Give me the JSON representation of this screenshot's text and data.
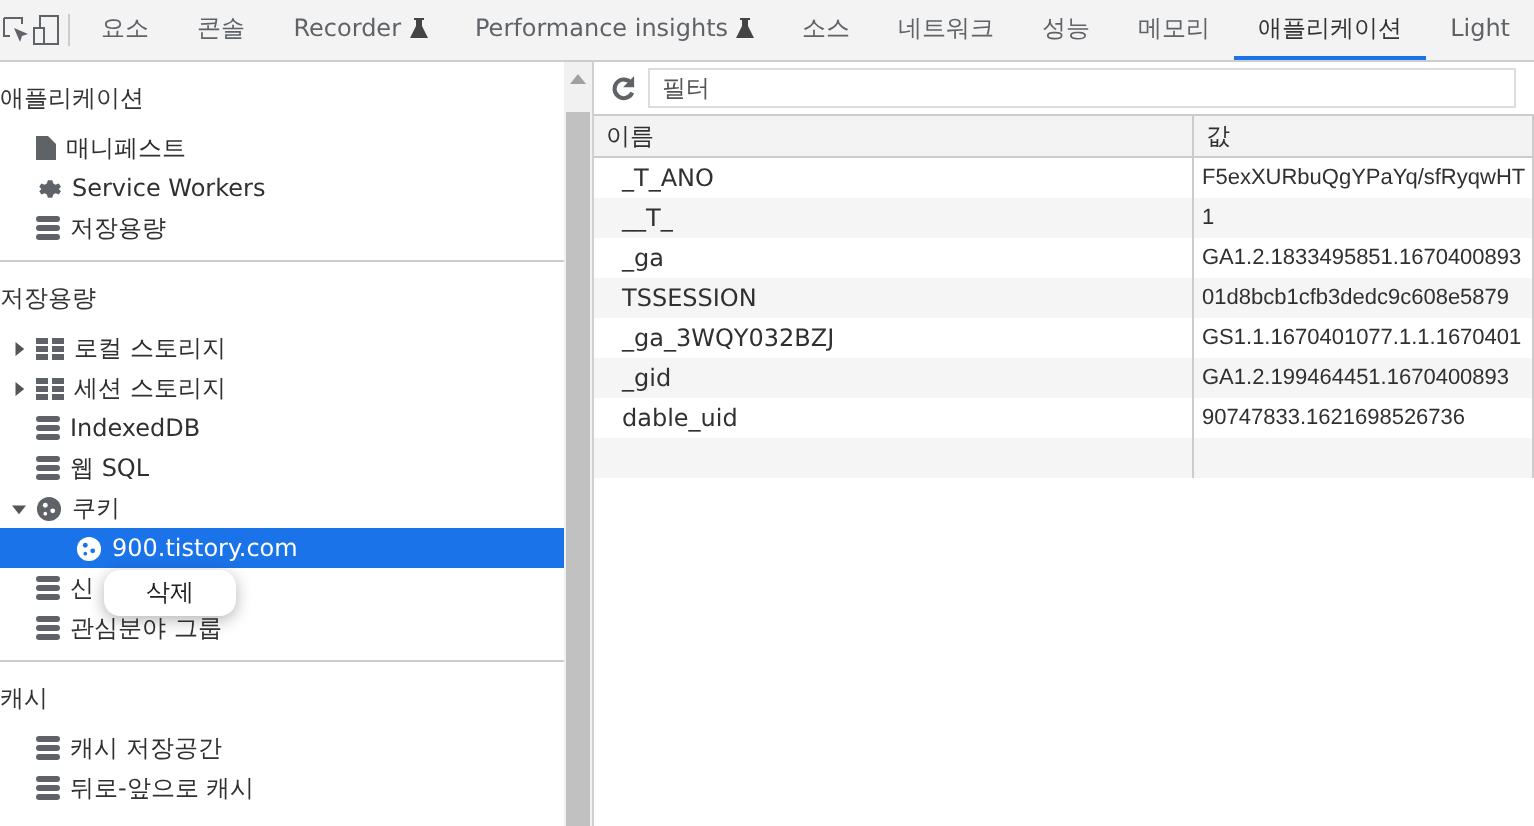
{
  "toolbar": {
    "tabs": [
      {
        "label": "요소",
        "selected": false,
        "experimental": false
      },
      {
        "label": "콘솔",
        "selected": false,
        "experimental": false
      },
      {
        "label": "Recorder",
        "selected": false,
        "experimental": true
      },
      {
        "label": "Performance insights",
        "selected": false,
        "experimental": true
      },
      {
        "label": "소스",
        "selected": false,
        "experimental": false
      },
      {
        "label": "네트워크",
        "selected": false,
        "experimental": false
      },
      {
        "label": "성능",
        "selected": false,
        "experimental": false
      },
      {
        "label": "메모리",
        "selected": false,
        "experimental": false
      },
      {
        "label": "애플리케이션",
        "selected": true,
        "experimental": false
      },
      {
        "label": "Light",
        "selected": false,
        "experimental": false
      }
    ]
  },
  "sidebar": {
    "sections": [
      {
        "title": "애플리케이션",
        "items": [
          {
            "label": "매니페스트",
            "kind": "file",
            "selected": false
          },
          {
            "label": "Service Workers",
            "kind": "gear",
            "selected": false
          },
          {
            "label": "저장용량",
            "kind": "db",
            "selected": false
          }
        ]
      },
      {
        "title": "저장용량",
        "items": [
          {
            "label": "로컬 스토리지",
            "kind": "grid",
            "selected": false,
            "expanded": false
          },
          {
            "label": "세션 스토리지",
            "kind": "grid",
            "selected": false,
            "expanded": false
          },
          {
            "label": "IndexedDB",
            "kind": "db",
            "selected": false
          },
          {
            "label": "웹 SQL",
            "kind": "db",
            "selected": false
          },
          {
            "label": "쿠키",
            "kind": "cookie",
            "selected": false,
            "expanded": true,
            "children": [
              {
                "label": "900.tistory.com",
                "kind": "cookie",
                "selected": true
              }
            ]
          },
          {
            "label": "신",
            "kind": "db",
            "selected": false
          },
          {
            "label": "관심분야 그룹",
            "kind": "db",
            "selected": false
          }
        ]
      },
      {
        "title": "캐시",
        "items": [
          {
            "label": "캐시 저장공간",
            "kind": "db",
            "selected": false
          },
          {
            "label": "뒤로-앞으로 캐시",
            "kind": "db",
            "selected": false
          }
        ]
      }
    ]
  },
  "context_menu": {
    "items": [
      "삭제"
    ]
  },
  "filter": {
    "placeholder": "필터"
  },
  "table": {
    "columns": [
      "이름",
      "값"
    ],
    "rows": [
      [
        "_T_ANO",
        "F5exXURbuQgYPaYq/sfRyqwHT"
      ],
      [
        "__T_",
        "1"
      ],
      [
        "_ga",
        "GA1.2.1833495851.1670400893"
      ],
      [
        "TSSESSION",
        "01d8bcb1cfb3dedc9c608e5879"
      ],
      [
        "_ga_3WQY032BZJ",
        "GS1.1.1670401077.1.1.1670401"
      ],
      [
        "_gid",
        "GA1.2.199464451.1670400893"
      ],
      [
        "dable_uid",
        "90747833.1621698526736"
      ]
    ]
  }
}
